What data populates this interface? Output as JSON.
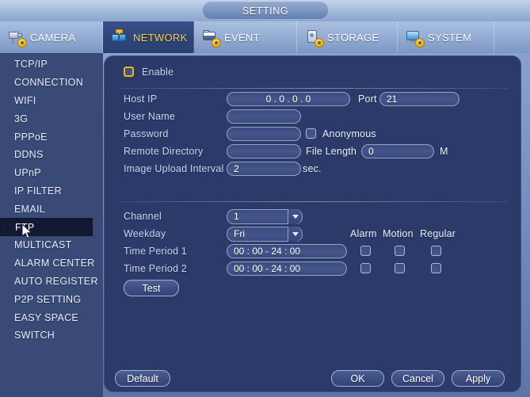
{
  "window": {
    "title": "SETTING"
  },
  "tabs": [
    {
      "label": "CAMERA",
      "icon": "camera-icon",
      "active": false
    },
    {
      "label": "NETWORK",
      "icon": "network-icon",
      "active": true
    },
    {
      "label": "EVENT",
      "icon": "event-icon",
      "active": false
    },
    {
      "label": "STORAGE",
      "icon": "storage-icon",
      "active": false
    },
    {
      "label": "SYSTEM",
      "icon": "system-icon",
      "active": false
    }
  ],
  "sidebar": {
    "items": [
      {
        "label": "TCP/IP",
        "active": false
      },
      {
        "label": "CONNECTION",
        "active": false
      },
      {
        "label": "WIFI",
        "active": false
      },
      {
        "label": "3G",
        "active": false
      },
      {
        "label": "PPPoE",
        "active": false
      },
      {
        "label": "DDNS",
        "active": false
      },
      {
        "label": "UPnP",
        "active": false
      },
      {
        "label": "IP FILTER",
        "active": false
      },
      {
        "label": "EMAIL",
        "active": false
      },
      {
        "label": "FTP",
        "active": true
      },
      {
        "label": "MULTICAST",
        "active": false
      },
      {
        "label": "ALARM CENTER",
        "active": false
      },
      {
        "label": "AUTO REGISTER",
        "active": false
      },
      {
        "label": "P2P SETTING",
        "active": false
      },
      {
        "label": "EASY SPACE",
        "active": false
      },
      {
        "label": "SWITCH",
        "active": false
      }
    ]
  },
  "form": {
    "enable": {
      "label": "Enable",
      "checked": false
    },
    "host_ip": {
      "label": "Host IP",
      "octets": [
        "0",
        "0",
        "0",
        "0"
      ],
      "value": "0   .   0   .   0   .   0"
    },
    "port": {
      "label": "Port",
      "value": "21"
    },
    "user_name": {
      "label": "User Name",
      "value": ""
    },
    "password": {
      "label": "Password",
      "value": ""
    },
    "anonymous": {
      "label": "Anonymous",
      "checked": false
    },
    "remote_directory": {
      "label": "Remote Directory",
      "value": ""
    },
    "file_length": {
      "label": "File Length",
      "value": "0",
      "unit": "M"
    },
    "image_upload_interval": {
      "label": "Image Upload Interval",
      "value": "2",
      "unit": "sec."
    },
    "channel": {
      "label": "Channel",
      "value": "1"
    },
    "weekday": {
      "label": "Weekday",
      "value": "Fri"
    },
    "columns": {
      "alarm": "Alarm",
      "motion": "Motion",
      "regular": "Regular"
    },
    "time_period_1": {
      "label": "Time Period 1",
      "value": "00 : 00          - 24 :  00",
      "alarm": false,
      "motion": false,
      "regular": false
    },
    "time_period_2": {
      "label": "Time Period 2",
      "value": "00 : 00          - 24 :  00",
      "alarm": false,
      "motion": false,
      "regular": false
    },
    "test_button": "Test"
  },
  "footer": {
    "default_label": "Default",
    "ok_label": "OK",
    "cancel_label": "Cancel",
    "apply_label": "Apply"
  },
  "colors": {
    "panel_bg": "#2c3a69",
    "sidebar_bg": "#3a4a77",
    "active_tab_text": "#ffd23c",
    "highlight_item_bg": "#121a33",
    "checkbox_focus": "#f2b705",
    "label_text": "#c8d6ef"
  }
}
